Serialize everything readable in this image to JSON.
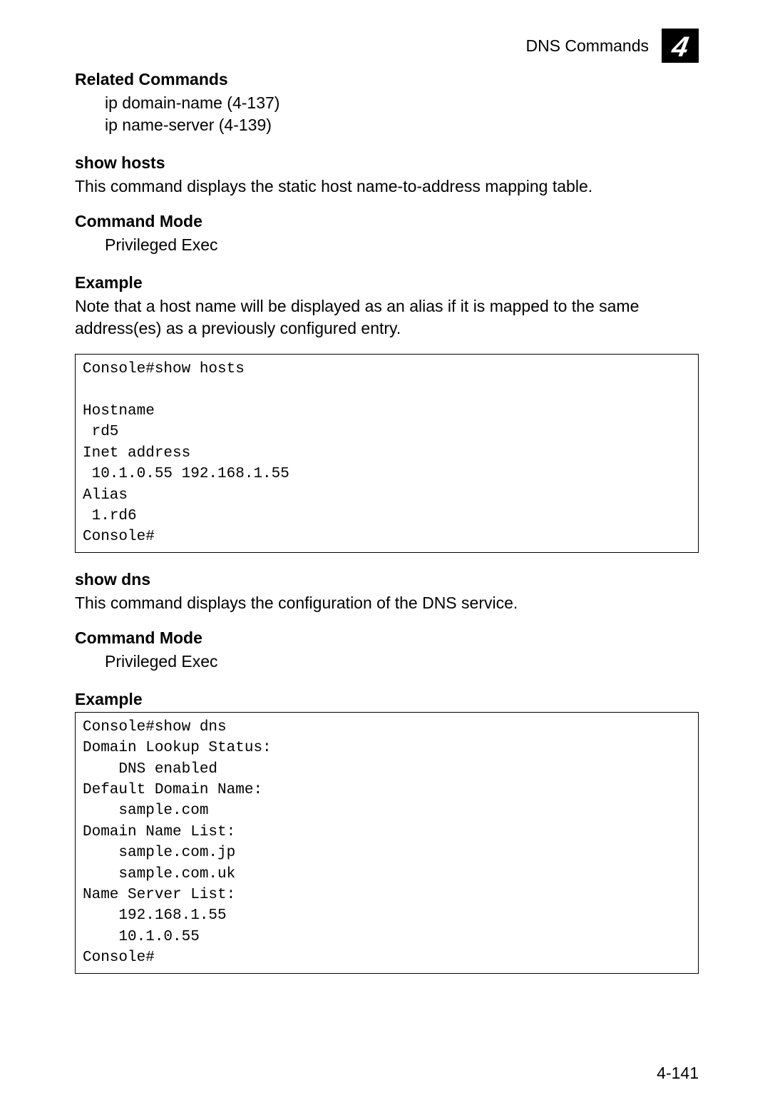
{
  "header": {
    "title": "DNS Commands",
    "chapter": "4"
  },
  "sections": {
    "related_commands": {
      "heading": "Related Commands",
      "items": [
        "ip domain-name (4-137)",
        "ip name-server (4-139)"
      ]
    },
    "show_hosts": {
      "heading": "show hosts",
      "description": "This command displays the static host name-to-address mapping table.",
      "command_mode_heading": "Command Mode",
      "command_mode_value": "Privileged Exec",
      "example_heading": "Example",
      "example_note": "Note that a host name will be displayed as an alias if it is mapped to the same address(es) as a previously configured entry.",
      "example_code": "Console#show hosts\n\nHostname\n rd5\nInet address\n 10.1.0.55 192.168.1.55\nAlias\n 1.rd6\nConsole#"
    },
    "show_dns": {
      "heading": "show dns",
      "description": "This command displays the configuration of the DNS service.",
      "command_mode_heading": "Command Mode",
      "command_mode_value": "Privileged Exec",
      "example_heading": "Example",
      "example_code": "Console#show dns\nDomain Lookup Status:\n    DNS enabled\nDefault Domain Name:\n    sample.com\nDomain Name List:\n    sample.com.jp\n    sample.com.uk\nName Server List:\n    192.168.1.55\n    10.1.0.55\nConsole#"
    }
  },
  "footer": {
    "page_number": "4-141"
  }
}
